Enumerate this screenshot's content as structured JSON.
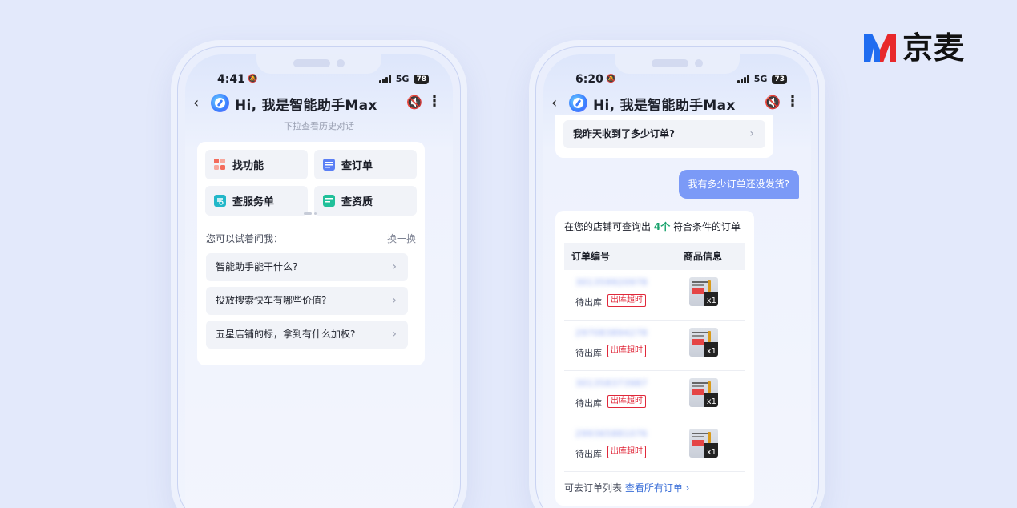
{
  "brand": {
    "name": "京麦"
  },
  "phones": [
    {
      "status": {
        "time": "4:41",
        "network": "5G",
        "battery": "78"
      },
      "header": {
        "back_icon": "‹",
        "title": "Hi, 我是智能助手Max",
        "mute_icon": "🔇",
        "more_icon": "⋮"
      },
      "pull_hint": "下拉查看历史对话",
      "functions": [
        {
          "label": "找功能",
          "color": "#f36b5b"
        },
        {
          "label": "查订单",
          "color": "#5b7ff5"
        },
        {
          "label": "查服务单",
          "color": "#22b7c9"
        },
        {
          "label": "查资质",
          "color": "#20c09a"
        }
      ],
      "try_label": "您可以试着问我：",
      "refresh_label": "换一换",
      "suggestions": [
        "智能助手能干什么?",
        "投放搜索快车有哪些价值?",
        "五星店铺的标，拿到有什么加权?"
      ]
    },
    {
      "status": {
        "time": "6:20",
        "network": "5G",
        "battery": "73"
      },
      "header": {
        "back_icon": "‹",
        "title": "Hi, 我是智能助手Max",
        "mute_icon": "🔇",
        "more_icon": "⋮"
      },
      "previous_question": "我昨天收到了多少订单?",
      "user_message": "我有多少订单还没发货?",
      "orders": {
        "title_prefix": "在您的店铺可查询出",
        "count": "4个",
        "title_suffix": "符合条件的订单",
        "columns": [
          "订单编号",
          "商品信息"
        ],
        "rows": [
          {
            "order_no": "301359920978",
            "status": "待出库",
            "tag": "出库超时",
            "qty": "x1"
          },
          {
            "order_no": "297083894278",
            "status": "待出库",
            "tag": "出库超时",
            "qty": "x1"
          },
          {
            "order_no": "301358373987",
            "status": "待出库",
            "tag": "出库超时",
            "qty": "x1"
          },
          {
            "order_no": "299365881076",
            "status": "待出库",
            "tag": "出库超时",
            "qty": "x1"
          }
        ],
        "footer_prefix": "可去订单列表",
        "footer_link": "查看所有订单 ›"
      }
    }
  ]
}
